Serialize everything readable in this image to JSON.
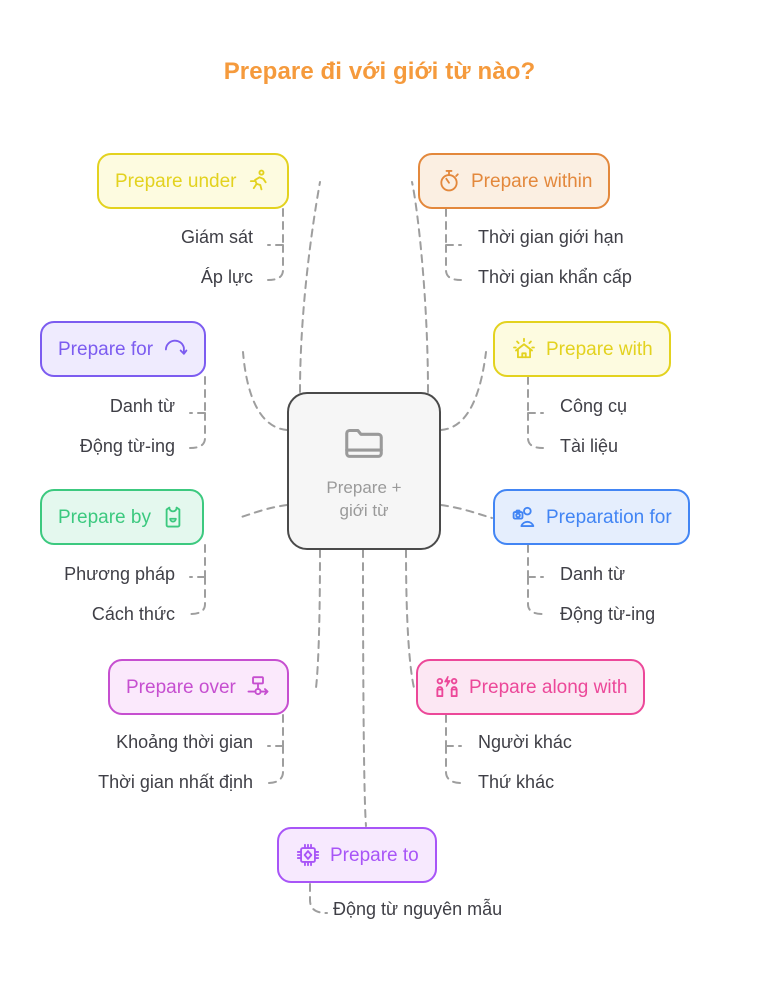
{
  "title": "Prepare đi với giới từ nào?",
  "center": {
    "line1": "Prepare +",
    "line2": "giới từ",
    "icon": "folder-icon"
  },
  "colors": {
    "title": "#F59A3C",
    "yellow": "#E3D21F",
    "yellow_fill": "#FDFBE0",
    "orange": "#E3883C",
    "orange_fill": "#FBEFE2",
    "violet": "#7C5CF0",
    "violet_fill": "#EFEBFE",
    "green": "#3CC97F",
    "green_fill": "#E4F8EE",
    "blue": "#4285F4",
    "blue_fill": "#E5EEFD",
    "magenta": "#C64FD0",
    "magenta_fill": "#FBE9FC",
    "pink": "#EC4899",
    "pink_fill": "#FCE7F3",
    "purple": "#A855F7",
    "purple_fill": "#F7E9FE",
    "connector": "#9E9E9E",
    "subtext": "#3F3F46",
    "center_border": "#4A4A4A",
    "center_fill": "#F6F6F6",
    "center_text": "#9A9A9A"
  },
  "branches": [
    {
      "id": "prepare-under",
      "label": "Prepare under",
      "icon": "running-person-icon",
      "color": "#E3D21F",
      "fill": "#FDFBE0",
      "children": [
        "Giám sát",
        "Áp lực"
      ]
    },
    {
      "id": "prepare-within",
      "label": "Prepare within",
      "icon": "stopwatch-icon",
      "color": "#E3883C",
      "fill": "#FBEFE2",
      "children": [
        "Thời gian giới hạn",
        "Thời gian khẩn cấp"
      ]
    },
    {
      "id": "prepare-for",
      "label": "Prepare for",
      "icon": "curved-arrow-icon",
      "color": "#7C5CF0",
      "fill": "#EFEBFE",
      "children": [
        "Danh từ",
        "Động từ-ing"
      ]
    },
    {
      "id": "prepare-with",
      "label": "Prepare with",
      "icon": "house-shine-icon",
      "color": "#E3D21F",
      "fill": "#FDFBE0",
      "children": [
        "Công cụ",
        "Tài liệu"
      ]
    },
    {
      "id": "prepare-by",
      "label": "Prepare by",
      "icon": "apron-icon",
      "color": "#3CC97F",
      "fill": "#E4F8EE",
      "children": [
        "Phương pháp",
        "Cách thức"
      ]
    },
    {
      "id": "preparation-for",
      "label": "Preparation for",
      "icon": "person-camera-icon",
      "color": "#4285F4",
      "fill": "#E5EEFD",
      "children": [
        "Danh từ",
        "Động từ-ing"
      ]
    },
    {
      "id": "prepare-over",
      "label": "Prepare over",
      "icon": "flow-arrow-icon",
      "color": "#C64FD0",
      "fill": "#FBE9FC",
      "children": [
        "Khoảng thời gian",
        "Thời gian nhất định"
      ]
    },
    {
      "id": "prepare-along-with",
      "label": "Prepare along with",
      "icon": "two-people-icon",
      "color": "#EC4899",
      "fill": "#FCE7F3",
      "children": [
        "Người khác",
        "Thứ khác"
      ]
    },
    {
      "id": "prepare-to",
      "label": "Prepare to",
      "icon": "chip-icon",
      "color": "#A855F7",
      "fill": "#F7E9FE",
      "children": [
        "Động từ nguyên mẫu"
      ]
    }
  ]
}
